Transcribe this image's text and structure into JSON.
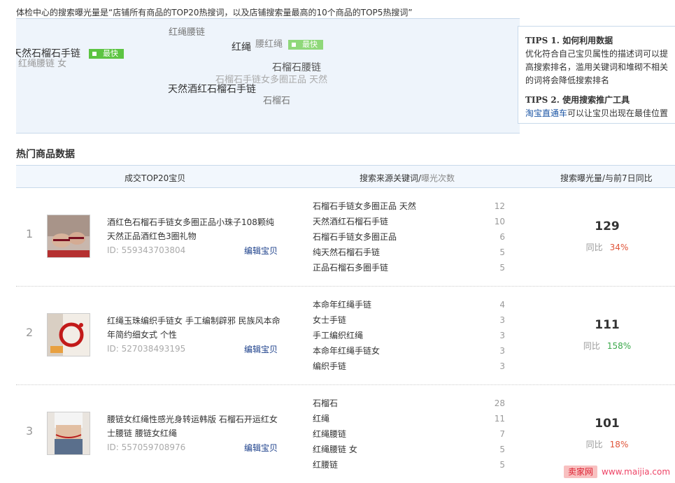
{
  "intro": "体检中心的搜索曝光量是“店铺所有商品的TOP20热搜词，以及店铺搜索量最高的10个商品的TOP5热搜词”",
  "cloud": {
    "words": [
      "红绳腰链",
      "天然石榴石手链",
      "红绳腰链 女",
      "红绳",
      "腰红绳",
      "石榴石腰链",
      "石榴石手链女多圈正品 天然",
      "天然酒红石榴石手链",
      "石榴石"
    ],
    "badge_fast": "最快"
  },
  "tips": {
    "t1_title": "TIPS 1. 如何利用数据",
    "t1_body": "优化符合自己宝贝属性的描述词可以提高搜索排名，滥用关键词和堆砌不相关的词将会降低搜索排名",
    "t2_title": "TIPS 2. 使用搜索推广工具",
    "t2_link": "淘宝直通车",
    "t2_body": "可以让宝贝出现在最佳位置"
  },
  "section_title": "热门商品数据",
  "headers": {
    "col1": "成交TOP20宝贝",
    "col2": "搜索来源关键词/",
    "col2_sub": "曝光次数",
    "col3": "搜索曝光量/与前7日同比"
  },
  "rows": [
    {
      "rank": "1",
      "title": "酒红色石榴石手链女多圈正品小珠子108颗纯天然正品酒红色3圈礼物",
      "id": "ID: 559343703804",
      "edit": "编辑宝贝",
      "keywords": [
        {
          "k": "石榴石手链女多圈正品 天然",
          "n": "12"
        },
        {
          "k": "天然酒红石榴石手链",
          "n": "10"
        },
        {
          "k": "石榴石手链女多圈正品",
          "n": "6"
        },
        {
          "k": "纯天然石榴石手链",
          "n": "5"
        },
        {
          "k": "正品石榴石多圈手链",
          "n": "5"
        }
      ],
      "volume": "129",
      "yoy_label": "同比",
      "yoy": "34%",
      "yoy_color": "#e0553a"
    },
    {
      "rank": "2",
      "title": "红绳玉珠编织手链女 手工编制辟邪 民族风本命年简约细女式 个性",
      "id": "ID: 527038493195",
      "edit": "编辑宝贝",
      "keywords": [
        {
          "k": "本命年红绳手链",
          "n": "4"
        },
        {
          "k": "女士手链",
          "n": "3"
        },
        {
          "k": "手工编织红绳",
          "n": "3"
        },
        {
          "k": "本命年红绳手链女",
          "n": "3"
        },
        {
          "k": "编织手链",
          "n": "3"
        }
      ],
      "volume": "111",
      "yoy_label": "同比",
      "yoy": "158%",
      "yoy_color": "#3aa84a"
    },
    {
      "rank": "3",
      "title": "腰链女红绳性感光身转运韩版 石榴石开运红女士腰链 腰链女红绳",
      "id": "ID: 557059708976",
      "edit": "编辑宝贝",
      "keywords": [
        {
          "k": "石榴石",
          "n": "28"
        },
        {
          "k": "红绳",
          "n": "11"
        },
        {
          "k": "红绳腰链",
          "n": "7"
        },
        {
          "k": "红绳腰链 女",
          "n": "5"
        },
        {
          "k": "红腰链",
          "n": "5"
        }
      ],
      "volume": "101",
      "yoy_label": "同比",
      "yoy": "18%",
      "yoy_color": "#e0553a"
    }
  ],
  "watermark": {
    "box": "卖家网",
    "url": "www.maijia.com"
  }
}
